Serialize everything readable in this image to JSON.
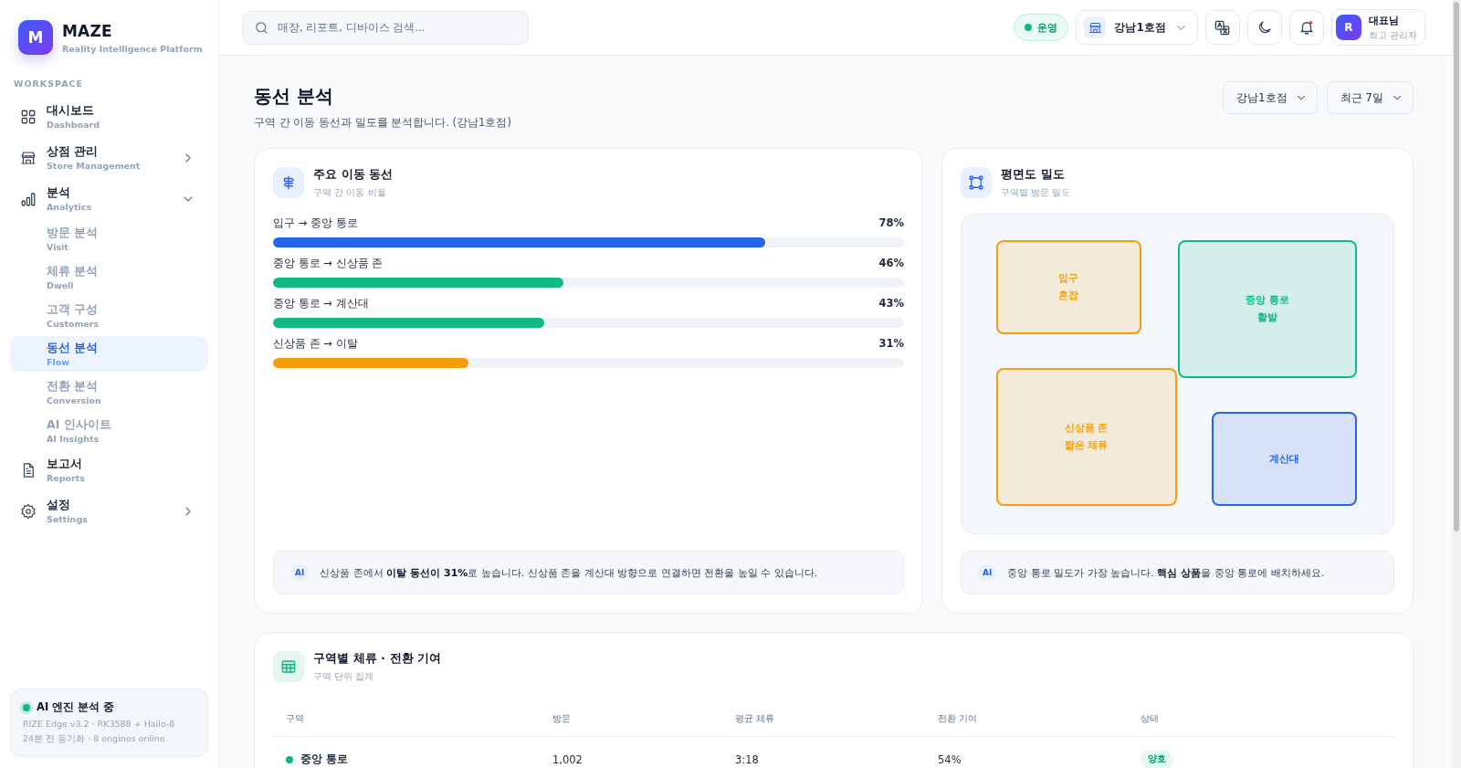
{
  "sidebar": {
    "logo": {
      "letter": "M",
      "name": "MAZE",
      "tagline": "Reality Intelligence Platform"
    },
    "section_label": "WORKSPACE",
    "items": [
      {
        "label": "대시보드",
        "sublabel": "Dashboard",
        "selected": false
      },
      {
        "label": "상점 관리",
        "sublabel": "Store Management",
        "selected": false,
        "expanded": false
      },
      {
        "label": "분석",
        "sublabel": "Analytics",
        "selected": false,
        "expanded": true,
        "children": [
          {
            "label": "방문 분석",
            "sublabel": "Visit",
            "selected": false
          },
          {
            "label": "체류 분석",
            "sublabel": "Dwell",
            "selected": false
          },
          {
            "label": "고객 구성",
            "sublabel": "Customers",
            "selected": false
          },
          {
            "label": "동선 분석",
            "sublabel": "Flow",
            "selected": true
          },
          {
            "label": "전환 분석",
            "sublabel": "Conversion",
            "selected": false
          },
          {
            "label": "AI 인사이트",
            "sublabel": "AI Insights",
            "selected": false
          }
        ]
      },
      {
        "label": "보고서",
        "sublabel": "Reports",
        "selected": false
      },
      {
        "label": "설정",
        "sublabel": "Settings",
        "selected": false,
        "expanded": false
      }
    ],
    "engine": {
      "title": "AI 엔진 분석 중",
      "color": "#10b981",
      "lines": [
        "RIZE Edge v3.2 · RK3588 + Hailo-8",
        "24분 전 동기화 · 8 engines online"
      ]
    }
  },
  "topbar": {
    "search": {
      "placeholder": "매장, 리포트, 디바이스 검색..."
    },
    "status": {
      "label": "운영",
      "color": "#10b981"
    },
    "store": "강남1호점",
    "user": {
      "initial": "R",
      "name": "대표님",
      "role": "최고 관리자"
    }
  },
  "page": {
    "title": "동선 분석",
    "subtitle": "구역 간 이동 동선과 밀도를 분석합니다. (강남1호점)",
    "filters": [
      "강남1호점",
      "최근 7일"
    ]
  },
  "flow_card": {
    "title": "주요 이동 동선",
    "subtitle": "구역 간 이동 비율",
    "flows": [
      {
        "label": "입구 → 중앙 통로",
        "value": "78%",
        "level": 0.78,
        "color": "#2563eb"
      },
      {
        "label": "중앙 통로 → 신상품 존",
        "value": "46%",
        "level": 0.46,
        "color": "#10b981"
      },
      {
        "label": "중앙 통로 → 계산대",
        "value": "43%",
        "level": 0.43,
        "color": "#10b981"
      },
      {
        "label": "신상품 존 → 이탈",
        "value": "31%",
        "level": 0.31,
        "color": "#f59e0b"
      }
    ],
    "note": {
      "badge": "AI",
      "text": "신상품 존에서 **이탈 동선이 31%**로 높습니다. 신상품 존을 계산대 방향으로 연결하면 전환을 높일 수 있습니다."
    }
  },
  "density_card": {
    "title": "평면도 밀도",
    "subtitle": "구역별 방문 밀도",
    "zones": [
      {
        "label": "입구",
        "status": "혼잡",
        "color": "#f59e0b"
      },
      {
        "label": "중앙 통로",
        "status": "활발",
        "color": "#10b981"
      },
      {
        "label": "신상품 존",
        "status": "짧은 체류",
        "color": "#f59e0b"
      },
      {
        "label": "계산대",
        "color": "#2563eb"
      }
    ],
    "note": {
      "badge": "AI",
      "text": "중앙 통로 밀도가 가장 높습니다. **핵심 상품**을 중앙 통로에 배치하세요."
    }
  },
  "table_card": {
    "title": "구역별 체류 · 전환 기여",
    "subtitle": "구역 단위 집계",
    "columns": [
      "구역",
      "방문",
      "평균 체류",
      "전환 기여",
      "상태"
    ],
    "rows": [
      {
        "zone": "중앙 통로",
        "color": "#10b981",
        "visits": "1,002",
        "avg_dwell": "3:18",
        "conversion": "54%",
        "status": "양호"
      }
    ]
  }
}
